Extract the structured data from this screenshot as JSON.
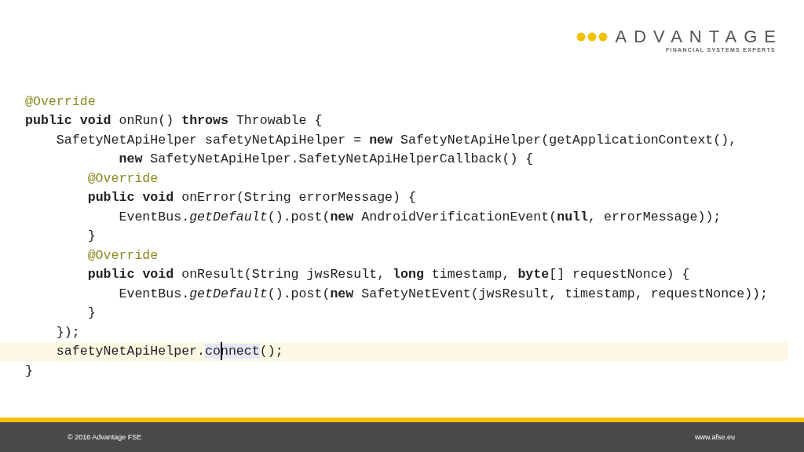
{
  "logo": {
    "name": "ADVANTAGE",
    "tagline": "FINANCIAL SYSTEMS EXPERTS"
  },
  "code": {
    "lines": [
      {
        "kind": "annotation",
        "text": "@Override",
        "current": false
      },
      {
        "kind": "code",
        "text": "**public** **void** onRun() **throws** Throwable {",
        "current": false
      },
      {
        "kind": "code",
        "text": "    SafetyNetApiHelper safetyNetApiHelper = **new** SafetyNetApiHelper(getApplicationContext(),",
        "current": false
      },
      {
        "kind": "code",
        "text": "            **new** SafetyNetApiHelper.SafetyNetApiHelperCallback() {",
        "current": false
      },
      {
        "kind": "annotation",
        "text": "        @Override",
        "current": false
      },
      {
        "kind": "code",
        "text": "        **public** **void** onError(String errorMessage) {",
        "current": false
      },
      {
        "kind": "code",
        "text": "            EventBus.*getDefault*().post(**new** AndroidVerificationEvent(**null**, errorMessage));",
        "current": false
      },
      {
        "kind": "code",
        "text": "        }",
        "current": false
      },
      {
        "kind": "annotation",
        "text": "        @Override",
        "current": false
      },
      {
        "kind": "code",
        "text": "        **public** **void** onResult(String jwsResult, **long** timestamp, **byte**[] requestNonce) {",
        "current": false
      },
      {
        "kind": "code",
        "text": "            EventBus.*getDefault*().post(**new** SafetyNetEvent(jwsResult, timestamp, requestNonce));",
        "current": false
      },
      {
        "kind": "code",
        "text": "        }",
        "current": false
      },
      {
        "kind": "code",
        "text": "    });",
        "current": false
      },
      {
        "kind": "code",
        "text": "    safetyNetApiHelper.",
        "highlight": "connect",
        "rest": "();",
        "current": true
      },
      {
        "kind": "code",
        "text": "}",
        "current": false
      }
    ]
  },
  "footer": {
    "copyright": "© 2016 Advantage FSE",
    "website": "www.afse.eu"
  }
}
